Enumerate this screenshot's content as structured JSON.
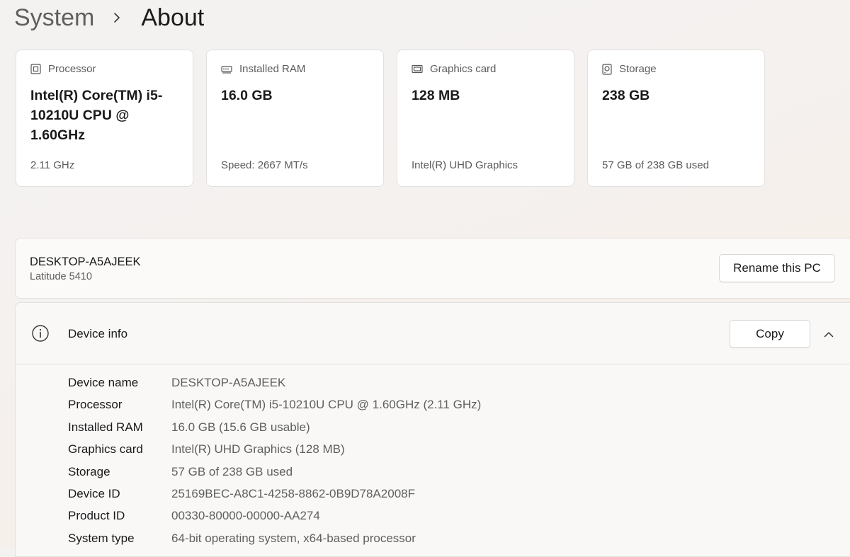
{
  "breadcrumb": {
    "parent": "System",
    "separator_icon": "chevron-right-icon",
    "current": "About"
  },
  "cards": [
    {
      "icon": "processor-icon",
      "label": "Processor",
      "value": "Intel(R) Core(TM) i5-10210U CPU @ 1.60GHz",
      "sub": "2.11 GHz"
    },
    {
      "icon": "ram-icon",
      "label": "Installed RAM",
      "value": "16.0 GB",
      "sub": "Speed: 2667 MT/s"
    },
    {
      "icon": "graphics-card-icon",
      "label": "Graphics card",
      "value": "128 MB",
      "sub": "Intel(R) UHD Graphics"
    },
    {
      "icon": "storage-icon",
      "label": "Storage",
      "value": "238 GB",
      "sub": "57 GB of 238 GB used"
    }
  ],
  "pc": {
    "name": "DESKTOP-A5AJEEK",
    "model": "Latitude 5410",
    "rename_label": "Rename this PC"
  },
  "device_info": {
    "icon": "info-icon",
    "title": "Device info",
    "copy_label": "Copy",
    "collapse_icon": "chevron-up-icon",
    "specs": [
      {
        "label": "Device name",
        "value": "DESKTOP-A5AJEEK"
      },
      {
        "label": "Processor",
        "value": "Intel(R) Core(TM) i5-10210U CPU @ 1.60GHz (2.11 GHz)"
      },
      {
        "label": "Installed RAM",
        "value": "16.0 GB (15.6 GB usable)"
      },
      {
        "label": "Graphics card",
        "value": "Intel(R) UHD Graphics (128 MB)"
      },
      {
        "label": "Storage",
        "value": "57 GB of 238 GB used"
      },
      {
        "label": "Device ID",
        "value": "25169BEC-A8C1-4258-8862-0B9D78A2008F"
      },
      {
        "label": "Product ID",
        "value": "00330-80000-00000-AA274"
      },
      {
        "label": "System type",
        "value": "64-bit operating system, x64-based processor"
      }
    ]
  }
}
